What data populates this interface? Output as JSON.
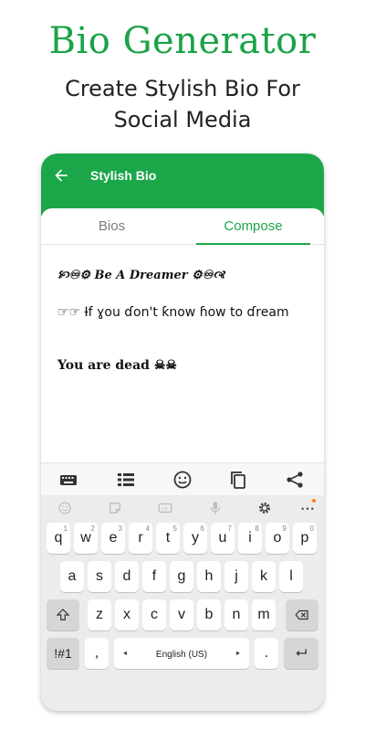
{
  "promo": {
    "title": "Bio Generator",
    "subtitle_line1": "Create Stylish Bio For",
    "subtitle_line2": "Social Media"
  },
  "appbar": {
    "title": "Stylish Bio"
  },
  "tabs": [
    {
      "label": "Bios",
      "selected": false
    },
    {
      "label": "Compose",
      "selected": true
    }
  ],
  "bios": [
    "🙡♾⚙ Be A Dreamer ⚙♾🙣",
    "☞☞ Ɨf ɣou ɗon't ƙnow ɦow to ɗream",
    "You are dead ☠☠"
  ],
  "toolbar": {
    "icons": [
      "keyboard-icon",
      "list-icon",
      "emoji-icon",
      "copy-icon",
      "share-icon"
    ]
  },
  "keyboard": {
    "top_icons": [
      "emoji-icon",
      "sticker-icon",
      "gif-icon",
      "mic-icon",
      "settings-icon",
      "more-icon"
    ],
    "row1": [
      {
        "k": "q",
        "h": "1"
      },
      {
        "k": "w",
        "h": "2"
      },
      {
        "k": "e",
        "h": "3"
      },
      {
        "k": "r",
        "h": "4"
      },
      {
        "k": "t",
        "h": "5"
      },
      {
        "k": "y",
        "h": "6"
      },
      {
        "k": "u",
        "h": "7"
      },
      {
        "k": "i",
        "h": "8"
      },
      {
        "k": "o",
        "h": "9"
      },
      {
        "k": "p",
        "h": "0"
      }
    ],
    "row2": [
      "a",
      "s",
      "d",
      "f",
      "g",
      "h",
      "j",
      "k",
      "l"
    ],
    "row3": [
      "z",
      "x",
      "c",
      "v",
      "b",
      "n",
      "m"
    ],
    "symbols_label": "!#1",
    "comma": ",",
    "space_label": "English (US)",
    "period": "."
  },
  "colors": {
    "accent": "#1ca64a",
    "title": "#1aa347"
  }
}
